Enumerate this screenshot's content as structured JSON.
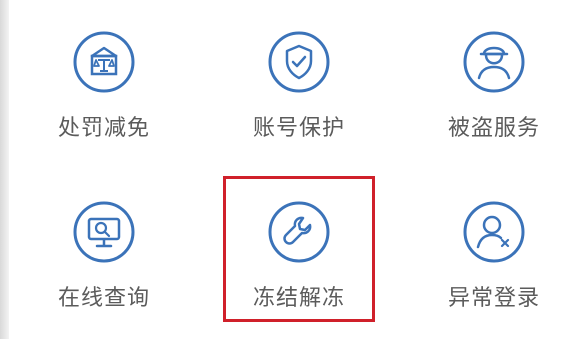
{
  "colors": {
    "icon_stroke": "#3b73b9",
    "label": "#5b5b5b",
    "highlight": "#d0202a"
  },
  "tiles": [
    {
      "label": "处罚减免",
      "icon": "courthouse-icon"
    },
    {
      "label": "账号保护",
      "icon": "shield-check-icon"
    },
    {
      "label": "被盗服务",
      "icon": "thief-icon"
    },
    {
      "label": "在线查询",
      "icon": "monitor-search-icon"
    },
    {
      "label": "冻结解冻",
      "icon": "wrench-icon"
    },
    {
      "label": "异常登录",
      "icon": "user-alert-icon"
    }
  ],
  "highlight": {
    "selected_tile": "冻结解冻"
  }
}
